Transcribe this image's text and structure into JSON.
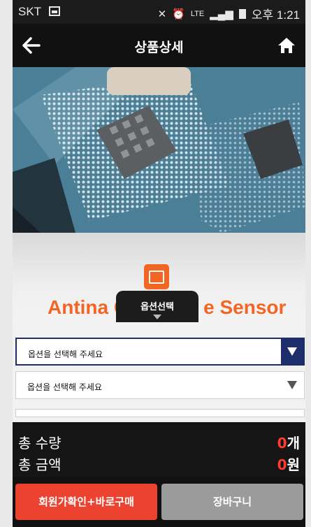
{
  "status_bar": {
    "carrier": "SKT",
    "network": "LTE",
    "time": "오후 1:21",
    "icons": [
      "gallery-icon",
      "mute-icon",
      "alarm-icon",
      "signal-icon",
      "battery-icon"
    ]
  },
  "header": {
    "title": "상품상세",
    "back_icon": "arrow-left-icon",
    "home_icon": "home-icon"
  },
  "product": {
    "image_caption": "Antina C",
    "image_caption_right": "e Sensor"
  },
  "option_tab": {
    "label": "옵션선택"
  },
  "options": {
    "select1": "옵션을 선택해 주세요",
    "select2": "옵션을 선택해 주세요"
  },
  "totals": {
    "qty_label": "총 수량",
    "qty_value": "0",
    "qty_unit": "개",
    "amount_label": "총 금액",
    "amount_value": "0",
    "amount_unit": "원"
  },
  "buttons": {
    "buy": "회원가확인+바로구매",
    "cart": "장바구니"
  },
  "colors": {
    "header_bg": "#111111",
    "select_accent": "#1d2e6b",
    "buy_button": "#ec4230",
    "cart_button": "#9b9b9b",
    "total_number": "#ff3b2f",
    "brand_orange": "#f26522"
  }
}
